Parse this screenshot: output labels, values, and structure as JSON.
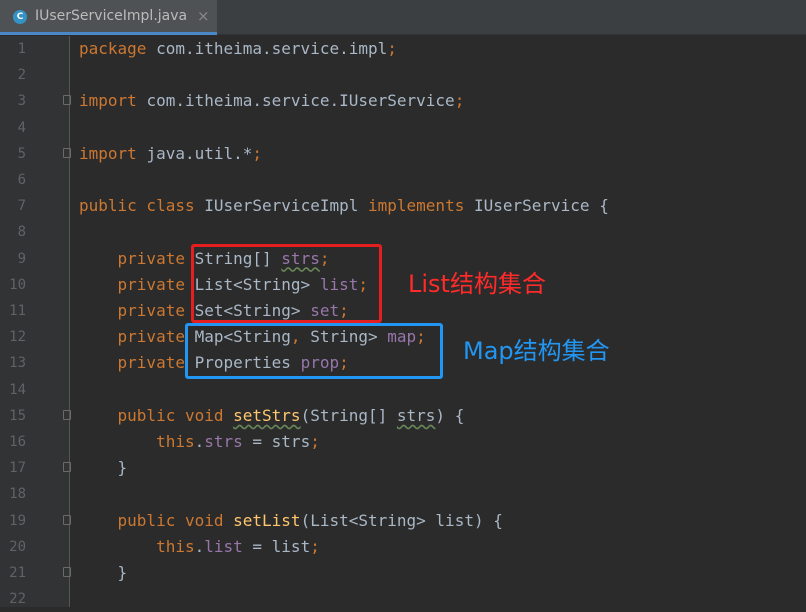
{
  "tab": {
    "icon_letter": "C",
    "title": "IUserServiceImpl.java",
    "close": "×"
  },
  "lines": [
    {
      "n": "1",
      "tokens": [
        {
          "t": "package ",
          "c": "kw"
        },
        {
          "t": "com.itheima.service.impl",
          "c": "plain"
        },
        {
          "t": ";",
          "c": "kw"
        }
      ]
    },
    {
      "n": "2",
      "tokens": []
    },
    {
      "n": "3",
      "tokens": [
        {
          "t": "import ",
          "c": "kw"
        },
        {
          "t": "com.itheima.service.IUserService",
          "c": "plain"
        },
        {
          "t": ";",
          "c": "kw"
        }
      ],
      "fold": true
    },
    {
      "n": "4",
      "tokens": []
    },
    {
      "n": "5",
      "tokens": [
        {
          "t": "import ",
          "c": "kw"
        },
        {
          "t": "java.util.*",
          "c": "plain"
        },
        {
          "t": ";",
          "c": "kw"
        }
      ],
      "fold": true
    },
    {
      "n": "6",
      "tokens": []
    },
    {
      "n": "7",
      "tokens": [
        {
          "t": "public class ",
          "c": "kw"
        },
        {
          "t": "IUserServiceImpl ",
          "c": "plain"
        },
        {
          "t": "implements ",
          "c": "kw"
        },
        {
          "t": "IUserService {",
          "c": "plain"
        }
      ]
    },
    {
      "n": "8",
      "tokens": []
    },
    {
      "n": "9",
      "tokens": [
        {
          "t": "    private ",
          "c": "kw"
        },
        {
          "t": "String[] ",
          "c": "plain"
        },
        {
          "t": "strs",
          "c": "fld typo"
        },
        {
          "t": ";",
          "c": "kw"
        }
      ]
    },
    {
      "n": "10",
      "tokens": [
        {
          "t": "    private ",
          "c": "kw"
        },
        {
          "t": "List<String> ",
          "c": "plain"
        },
        {
          "t": "list",
          "c": "fld"
        },
        {
          "t": ";",
          "c": "kw"
        }
      ]
    },
    {
      "n": "11",
      "tokens": [
        {
          "t": "    private ",
          "c": "kw"
        },
        {
          "t": "Set<String> ",
          "c": "plain"
        },
        {
          "t": "set",
          "c": "fld"
        },
        {
          "t": ";",
          "c": "kw"
        }
      ]
    },
    {
      "n": "12",
      "tokens": [
        {
          "t": "    private ",
          "c": "kw"
        },
        {
          "t": "Map<String",
          "c": "plain"
        },
        {
          "t": ", ",
          "c": "kw"
        },
        {
          "t": "String> ",
          "c": "plain"
        },
        {
          "t": "map",
          "c": "fld"
        },
        {
          "t": ";",
          "c": "kw"
        }
      ]
    },
    {
      "n": "13",
      "tokens": [
        {
          "t": "    private ",
          "c": "kw"
        },
        {
          "t": "Properties ",
          "c": "plain"
        },
        {
          "t": "prop",
          "c": "fld"
        },
        {
          "t": ";",
          "c": "kw"
        }
      ]
    },
    {
      "n": "14",
      "tokens": []
    },
    {
      "n": "15",
      "tokens": [
        {
          "t": "    public void ",
          "c": "kw"
        },
        {
          "t": "setStrs",
          "c": "mth typo"
        },
        {
          "t": "(String[] ",
          "c": "plain"
        },
        {
          "t": "strs",
          "c": "plain typo"
        },
        {
          "t": ") {",
          "c": "plain"
        }
      ],
      "fold": true
    },
    {
      "n": "16",
      "tokens": [
        {
          "t": "        this",
          "c": "kw"
        },
        {
          "t": ".",
          "c": "plain"
        },
        {
          "t": "strs",
          "c": "fld"
        },
        {
          "t": " = strs",
          "c": "plain"
        },
        {
          "t": ";",
          "c": "kw"
        }
      ]
    },
    {
      "n": "17",
      "tokens": [
        {
          "t": "    }",
          "c": "plain"
        }
      ],
      "fold": true
    },
    {
      "n": "18",
      "tokens": []
    },
    {
      "n": "19",
      "tokens": [
        {
          "t": "    public void ",
          "c": "kw"
        },
        {
          "t": "setList",
          "c": "mth"
        },
        {
          "t": "(List<String> list) {",
          "c": "plain"
        }
      ],
      "fold": true
    },
    {
      "n": "20",
      "tokens": [
        {
          "t": "        this",
          "c": "kw"
        },
        {
          "t": ".",
          "c": "plain"
        },
        {
          "t": "list",
          "c": "fld"
        },
        {
          "t": " = list",
          "c": "plain"
        },
        {
          "t": ";",
          "c": "kw"
        }
      ]
    },
    {
      "n": "21",
      "tokens": [
        {
          "t": "    }",
          "c": "plain"
        }
      ],
      "fold": true
    },
    {
      "n": "22",
      "tokens": []
    }
  ],
  "annotations": {
    "list_label": "List结构集合",
    "map_label": "Map结构集合",
    "red": "#e51f1f",
    "blue": "#2196f3"
  },
  "colors": {
    "keyword": "#cc7832",
    "field": "#9876aa",
    "method": "#ffc66d",
    "plain": "#a9b7c6",
    "background": "#2b2b2b"
  }
}
